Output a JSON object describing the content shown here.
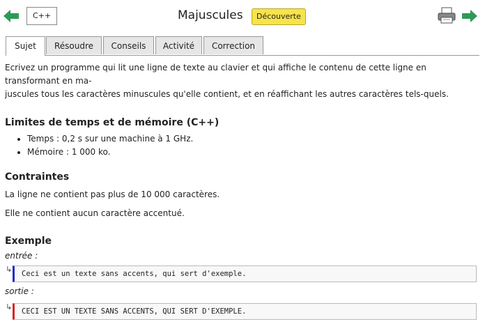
{
  "header": {
    "lang_label": "C++",
    "title": "Majuscules",
    "badge": "Découverte",
    "icons": {
      "prev": "arrow-left-icon",
      "next": "arrow-right-icon",
      "print": "printer-icon"
    },
    "colors": {
      "arrow": "#2e9a57",
      "badge": "#f7e34a"
    }
  },
  "tabs": [
    {
      "label": "Sujet",
      "active": true
    },
    {
      "label": "Résoudre",
      "active": false
    },
    {
      "label": "Conseils",
      "active": false
    },
    {
      "label": "Activité",
      "active": false
    },
    {
      "label": "Correction",
      "active": false
    }
  ],
  "statement": {
    "line1": "Ecrivez un programme qui lit une ligne de texte au clavier et qui affiche le contenu de cette ligne en transformant en ma-",
    "line2": "juscules tous les caractères minuscules qu'elle contient, et en réaffichant les autres caractères tels-quels."
  },
  "limits": {
    "heading": "Limites de temps et de mémoire (C++)",
    "items": [
      "Temps : 0,2 s sur une machine à 1 GHz.",
      "Mémoire : 1 000 ko."
    ]
  },
  "constraints": {
    "heading": "Contraintes",
    "lines": [
      "La ligne ne contient pas plus de 10 000 caractères.",
      "Elle ne contient aucun caractère accentué."
    ]
  },
  "example": {
    "heading": "Exemple",
    "input_label": "entrée :",
    "input": "Ceci est un texte sans accents, qui sert d'exemple.",
    "output_label": "sortie :",
    "output": "CECI EST UN TEXTE SANS ACCENTS, QUI SERT D'EXEMPLE.",
    "colors": {
      "input_bar": "#1f2ccc",
      "output_bar": "#d92020"
    }
  }
}
